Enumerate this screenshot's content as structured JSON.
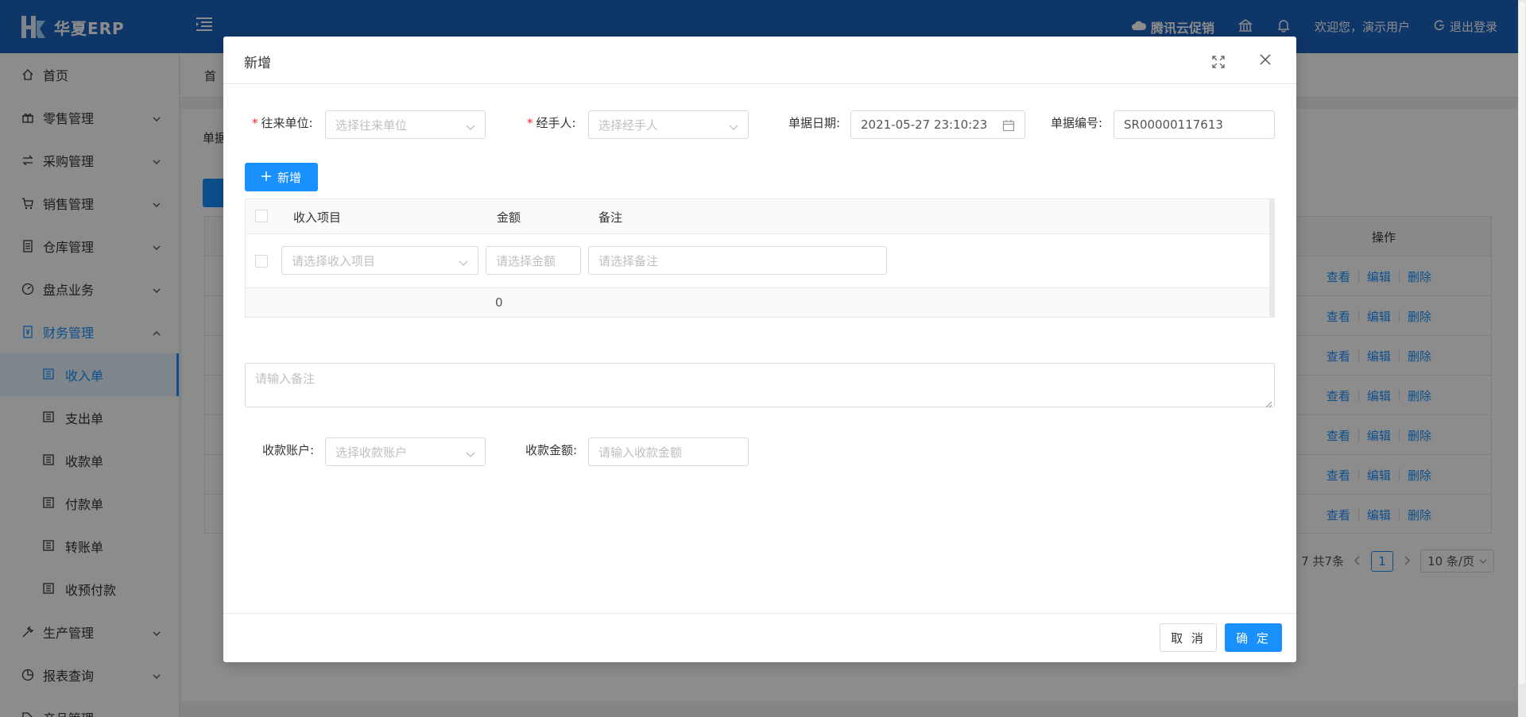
{
  "header": {
    "app_name": "华夏ERP",
    "brand_link": "腾讯云促销",
    "welcome": "欢迎您，演示用户",
    "logout": "退出登录"
  },
  "sidebar": {
    "items": [
      {
        "label": "首页",
        "icon": "home-icon"
      },
      {
        "label": "零售管理",
        "icon": "gift-icon"
      },
      {
        "label": "采购管理",
        "icon": "swap-icon"
      },
      {
        "label": "销售管理",
        "icon": "cart-icon"
      },
      {
        "label": "仓库管理",
        "icon": "warehouse-icon"
      },
      {
        "label": "盘点业务",
        "icon": "dashboard-icon"
      },
      {
        "label": "财务管理",
        "icon": "account-book-icon"
      }
    ],
    "finance_sub": [
      {
        "label": "收入单"
      },
      {
        "label": "支出单"
      },
      {
        "label": "收款单"
      },
      {
        "label": "付款单"
      },
      {
        "label": "转账单"
      },
      {
        "label": "收预付款"
      }
    ],
    "after": [
      {
        "label": "生产管理",
        "icon": "tool-icon"
      },
      {
        "label": "报表查询",
        "icon": "pie-chart-icon"
      },
      {
        "label": "产品管理",
        "icon": "tag-icon"
      }
    ]
  },
  "background": {
    "tab_first": "首",
    "label": "单据",
    "ops_header": "操作",
    "row_actions": [
      "查看",
      "编辑",
      "删除"
    ],
    "pager_total": "7 共7条",
    "pager_current": "1",
    "pager_size": "10 条/页"
  },
  "modal": {
    "title": "新增",
    "form": {
      "partner_label": "往来单位:",
      "partner_placeholder": "选择往来单位",
      "handler_label": "经手人:",
      "handler_placeholder": "选择经手人",
      "date_label": "单据日期:",
      "date_value": "2021-05-27 23:10:23",
      "number_label": "单据编号:",
      "number_value": "SR00000117613"
    },
    "add_button": "新增",
    "table": {
      "headers": [
        "收入项目",
        "金额",
        "备注"
      ],
      "row": {
        "item_placeholder": "请选择收入项目",
        "amount_placeholder": "请选择金额",
        "remark_placeholder": "请选择备注"
      },
      "sum": "0"
    },
    "remark_placeholder": "请输入备注",
    "account_label": "收款账户:",
    "account_placeholder": "选择收款账户",
    "amount_label": "收款金额:",
    "amount_placeholder": "请输入收款金额",
    "cancel": "取 消",
    "ok": "确 定"
  },
  "colors": {
    "header_bg": "#1d63c0",
    "primary": "#1890ff",
    "required": "#f5222d"
  }
}
